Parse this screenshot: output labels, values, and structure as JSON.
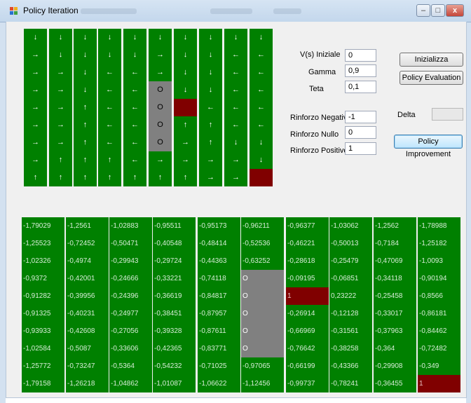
{
  "window": {
    "title": "Policy Iteration",
    "minimize_glyph": "–",
    "maximize_glyph": "□",
    "close_glyph": "x"
  },
  "policy_grid": [
    [
      "↓",
      "↓",
      "↓",
      "↓",
      "↓",
      "↓",
      "↓",
      "↓",
      "↓",
      "↓"
    ],
    [
      "→",
      "↓",
      "↓",
      "↓",
      "↓",
      "→",
      "↓",
      "↓",
      "←",
      "←"
    ],
    [
      "→",
      "→",
      "↓",
      "←",
      "←",
      "→",
      "↓",
      "↓",
      "←",
      "←"
    ],
    [
      "→",
      "→",
      "↓",
      "←",
      "←",
      "O",
      "↓",
      "↓",
      "←",
      "←"
    ],
    [
      "→",
      "→",
      "↑",
      "←",
      "←",
      "O",
      "",
      "←",
      "←",
      "←"
    ],
    [
      "→",
      "→",
      "↑",
      "←",
      "←",
      "O",
      "↑",
      "↑",
      "←",
      "←"
    ],
    [
      "→",
      "→",
      "↑",
      "←",
      "←",
      "O",
      "→",
      "↑",
      "↓",
      "↓"
    ],
    [
      "→",
      "↑",
      "↑",
      "↑",
      "←",
      "→",
      "→",
      "→",
      "→",
      "↓"
    ],
    [
      "↑",
      "↑",
      "↑",
      "↑",
      "↑",
      "↑",
      "↑",
      "→",
      "→",
      ""
    ]
  ],
  "policy_colors": {
    "grey": [
      [
        3,
        5
      ],
      [
        4,
        5
      ],
      [
        5,
        5
      ],
      [
        6,
        5
      ]
    ],
    "red": [
      [
        4,
        6
      ],
      [
        8,
        9
      ]
    ]
  },
  "params": {
    "v_iniziale": {
      "label": "V(s) Iniziale",
      "value": "0"
    },
    "gamma": {
      "label": "Gamma",
      "value": "0,9"
    },
    "teta": {
      "label": "Teta",
      "value": "0,1"
    },
    "rinforzo_negativo": {
      "label": "Rinforzo Negativo",
      "value": "-1"
    },
    "rinforzo_nullo": {
      "label": "Rinforzo Nullo",
      "value": "0"
    },
    "rinforzo_positivo": {
      "label": "Rinforzo Positivo",
      "value": "1"
    },
    "delta": {
      "label": "Delta",
      "value": ""
    }
  },
  "buttons": {
    "inizializza": "Inizializza",
    "policy_evaluation": "Policy Evaluation",
    "policy_improvement": "Policy Improvement"
  },
  "value_columns": [
    [
      "-1,79029",
      "-1,25523",
      "-1,02326",
      "-0,9372",
      "-0,91282",
      "-0,91325",
      "-0,93933",
      "-1,02584",
      "-1,25772",
      "-1,79158"
    ],
    [
      "-1,2561",
      "-0,72452",
      "-0,4974",
      "-0,42001",
      "-0,39956",
      "-0,40231",
      "-0,42608",
      "-0,5087",
      "-0,73247",
      "-1,26218"
    ],
    [
      "-1,02883",
      "-0,50471",
      "-0,29943",
      "-0,24666",
      "-0,24396",
      "-0,24977",
      "-0,27056",
      "-0,33606",
      "-0,5364",
      "-1,04862"
    ],
    [
      "-0,95511",
      "-0,40548",
      "-0,29724",
      "-0,33221",
      "-0,36619",
      "-0,38451",
      "-0,39328",
      "-0,42365",
      "-0,54232",
      "-1,01087"
    ],
    [
      "-0,95173",
      "-0,48414",
      "-0,44363",
      "-0,74118",
      "-0,84817",
      "-0,87957",
      "-0,87611",
      "-0,83771",
      "-0,71025",
      "-1,06622"
    ],
    [
      "-0,96211",
      "-0,52536",
      "-0,63252",
      "O",
      "O",
      "O",
      "O",
      "O",
      "-0,97065",
      "-1,12456"
    ],
    [
      "-0,96377",
      "-0,46221",
      "-0,28618",
      "-0,09195",
      "1",
      "-0,26914",
      "-0,66969",
      "-0,76642",
      "-0,66199",
      "-0,99737"
    ],
    [
      "-1,03062",
      "-0,50013",
      "-0,25479",
      "-0,06851",
      "0,23222",
      "-0,12128",
      "-0,31561",
      "-0,38258",
      "-0,43366",
      "-0,78241"
    ],
    [
      "-1,2562",
      "-0,7184",
      "-0,47069",
      "-0,34118",
      "-0,25458",
      "-0,33017",
      "-0,37963",
      "-0,364",
      "-0,29908",
      "-0,36455"
    ],
    [
      "-1,78988",
      "-1,25182",
      "-1,0093",
      "-0,90194",
      "-0,8566",
      "-0,86181",
      "-0,84462",
      "-0,72482",
      "-0,349",
      "1"
    ]
  ],
  "value_colors": {
    "grey_col": 5,
    "grey_rows": [
      3,
      4,
      5,
      6,
      7
    ],
    "red": [
      [
        6,
        4
      ],
      [
        9,
        9
      ]
    ]
  }
}
